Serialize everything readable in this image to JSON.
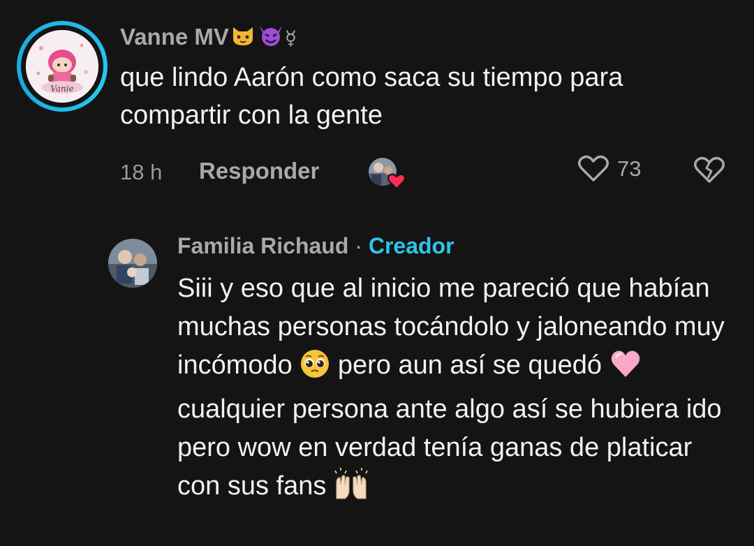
{
  "comment": {
    "username": "Vanne MV",
    "username_badges": [
      "cat-emoji",
      "smiling-devil-emoji",
      "mercury-symbol"
    ],
    "mercury_glyph": "☿",
    "avatar_text": "Vanie",
    "text": "que lindo Aarón como saca su tiempo para compartir con la gente",
    "time": "18 h",
    "reply_label": "Responder",
    "like_count": "73",
    "liked_by_creator": true,
    "accent_color": "#1fb6e8"
  },
  "reply": {
    "username": "Familia Richaud",
    "separator": "·",
    "creator_label": "Creador",
    "creator_color": "#2ec5ea",
    "text_parts": {
      "p1": "Siii y eso que al inicio me pareció que habían muchas personas tocándolo y jaloneando muy incómodo ",
      "p2": " pero aun así se quedó ",
      "p3": " cualquier persona ante algo así se hubiera ido pero wow en verdad tenía ganas de platicar con sus fans "
    },
    "emojis": [
      "pleading-face-emoji",
      "pink-heart-emoji",
      "raising-hands-emoji"
    ]
  }
}
